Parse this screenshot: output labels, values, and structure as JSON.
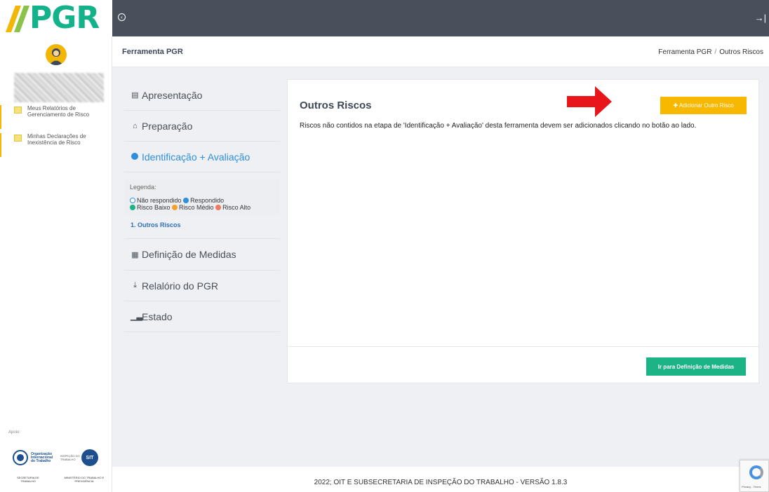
{
  "brand": {
    "logo_text": "PGR"
  },
  "sidebar": {
    "items": [
      {
        "label": "Meus Relatórios de Gerenciamento de Risco"
      },
      {
        "label": "Minhas Declarações de Inexistência de Risco"
      }
    ],
    "apoio_label": "Apoio:",
    "partners": {
      "oit": "Organização Internacional do Trabalho",
      "inspecao": "INSPEÇÃO DO TRABALHO",
      "sit": "SIT",
      "secretaria": "SECRETARIA DE TRABALHO",
      "ministerio": "MINISTÉRIO DO TRABALHO E PREVIDÊNCIA"
    }
  },
  "header": {
    "title": "Ferramenta PGR",
    "breadcrumb": [
      "Ferramenta PGR",
      "Outros Riscos"
    ]
  },
  "nav": {
    "items": [
      {
        "label": "Apresentação",
        "icon": "file-icon"
      },
      {
        "label": "Preparação",
        "icon": "home-icon"
      },
      {
        "label": "Identificação + Avaliação",
        "icon": "check-circle-icon"
      }
    ],
    "legend": {
      "title": "Legenda:",
      "nao_respondido": "Não respondido",
      "respondido": "Respondido",
      "risco_baixo": "Risco Baixo",
      "risco_medio": "Risco Médio",
      "risco_alto": "Risco Alto"
    },
    "sub_item": "1. Outros Riscos",
    "items_after": [
      {
        "label": "Definição de Medidas",
        "icon": "calendar-icon"
      },
      {
        "label": "Relalório do PGR",
        "icon": "download-icon"
      },
      {
        "label": "Estado",
        "icon": "bar-chart-icon"
      }
    ]
  },
  "main": {
    "title": "Outros Riscos",
    "description": "Riscos não contidos na etapa de 'Identificação + Avaliação' desta ferramenta devem ser adicionados clicando no botão ao lado.",
    "add_button": "✚ Adicionar Outro Risco",
    "next_button": "Ir para Definição de Medidas"
  },
  "footer": {
    "text": "2022; OIT E SUBSECRETARIA DE INSPEÇÃO DO TRABALHO - VERSÃO 1.8.3"
  },
  "recaptcha": {
    "text": "Privacy - Terms"
  },
  "colors": {
    "topbar": "#4a4f5c",
    "accent_yellow": "#f8b800",
    "accent_green": "#1cb386",
    "active_blue": "#2e8fdc",
    "logo_green": "#13b28a"
  }
}
